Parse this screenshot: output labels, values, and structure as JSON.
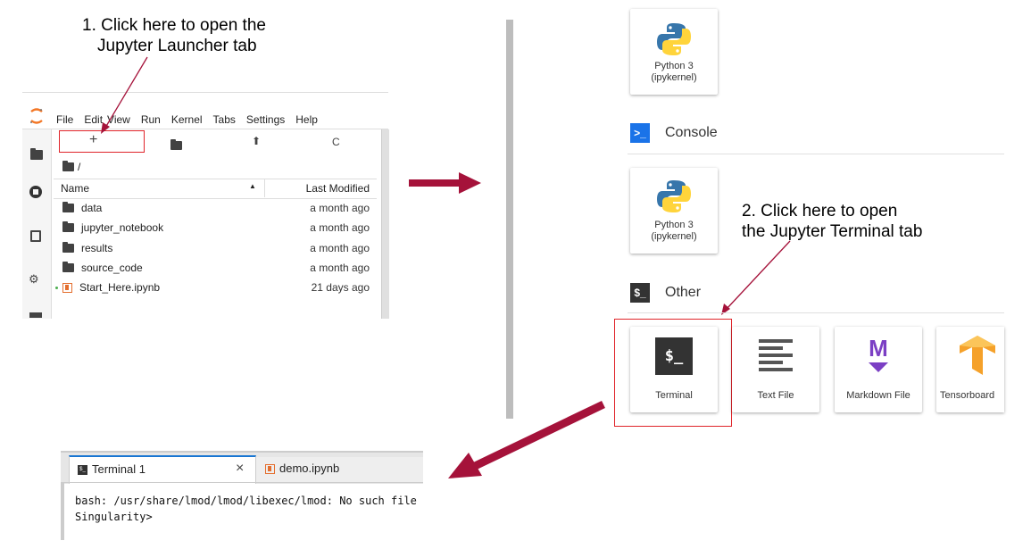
{
  "annotations": {
    "step1_line1": "1. Click here to open the",
    "step1_line2": "Jupyter Launcher tab",
    "step2_line1": "2. Click here to open",
    "step2_line2": "the Jupyter Terminal tab"
  },
  "jupyterlab": {
    "menu": [
      "File",
      "Edit",
      "View",
      "Run",
      "Kernel",
      "Tabs",
      "Settings",
      "Help"
    ],
    "toolbar": {
      "new_launcher": "+",
      "refresh": "C"
    },
    "path": "/",
    "columns": {
      "name": "Name",
      "modified": "Last Modified"
    },
    "files": [
      {
        "name": "data",
        "modified": "a month ago",
        "type": "folder"
      },
      {
        "name": "jupyter_notebook",
        "modified": "a month ago",
        "type": "folder"
      },
      {
        "name": "results",
        "modified": "a month ago",
        "type": "folder"
      },
      {
        "name": "source_code",
        "modified": "a month ago",
        "type": "folder"
      },
      {
        "name": "Start_Here.ipynb",
        "modified": "21 days ago",
        "type": "notebook"
      }
    ]
  },
  "launcher": {
    "notebook_card": {
      "line1": "Python 3",
      "line2": "(ipykernel)"
    },
    "console": {
      "title": "Console",
      "icon_text": ">_"
    },
    "console_card": {
      "line1": "Python 3",
      "line2": "(ipykernel)"
    },
    "other": {
      "title": "Other",
      "icon_text": "$_"
    },
    "other_cards": [
      {
        "label": "Terminal",
        "icon": "terminal-icon",
        "icon_text": "$_"
      },
      {
        "label": "Text File",
        "icon": "text-file-icon"
      },
      {
        "label": "Markdown File",
        "icon": "markdown-icon",
        "icon_text": "M"
      },
      {
        "label": "Tensorboard",
        "icon": "tensorboard-icon"
      }
    ]
  },
  "terminal": {
    "tabs": [
      {
        "label": "Terminal 1",
        "close": "×"
      },
      {
        "label": "demo.ipynb"
      }
    ],
    "lines": [
      "bash: /usr/share/lmod/lmod/libexec/lmod: No such file",
      "Singularity>"
    ]
  },
  "colors": {
    "highlight": "#e0242a",
    "arrow": "#a5123a",
    "notebook_orange": "#e46e2e",
    "console_blue": "#1a73e8"
  }
}
